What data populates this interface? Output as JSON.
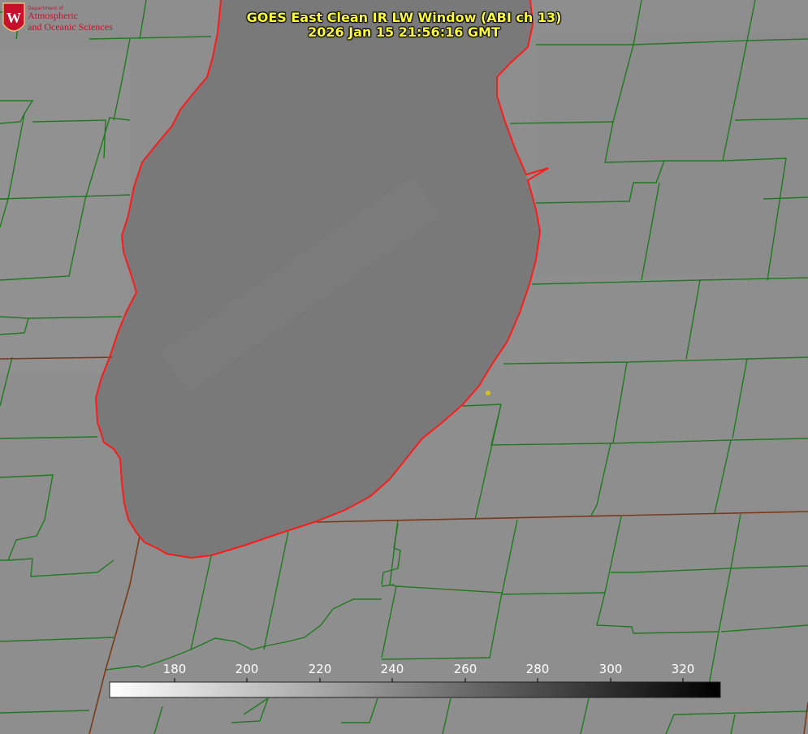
{
  "title": {
    "line1": "GOES East Clean IR LW Window (ABI ch 13)",
    "line2": "2026 Jan 15 21:56:16 GMT"
  },
  "logo": {
    "department": "Department of",
    "line1": "Atmospheric",
    "line2": "and Oceanic Sciences"
  },
  "colorbar": {
    "ticks": [
      "180",
      "200",
      "220",
      "240",
      "260",
      "280",
      "300",
      "320"
    ],
    "gradient_start": "#ffffff",
    "gradient_end": "#000000"
  },
  "colors": {
    "background": "#8e8e8e",
    "lake": "#787878",
    "county_lines": "#1f7a1f",
    "lake_shore": "#ff1a1a",
    "state_lines": "#7a3a1a",
    "title": "#ffff33",
    "marker": "#d4c21a"
  }
}
